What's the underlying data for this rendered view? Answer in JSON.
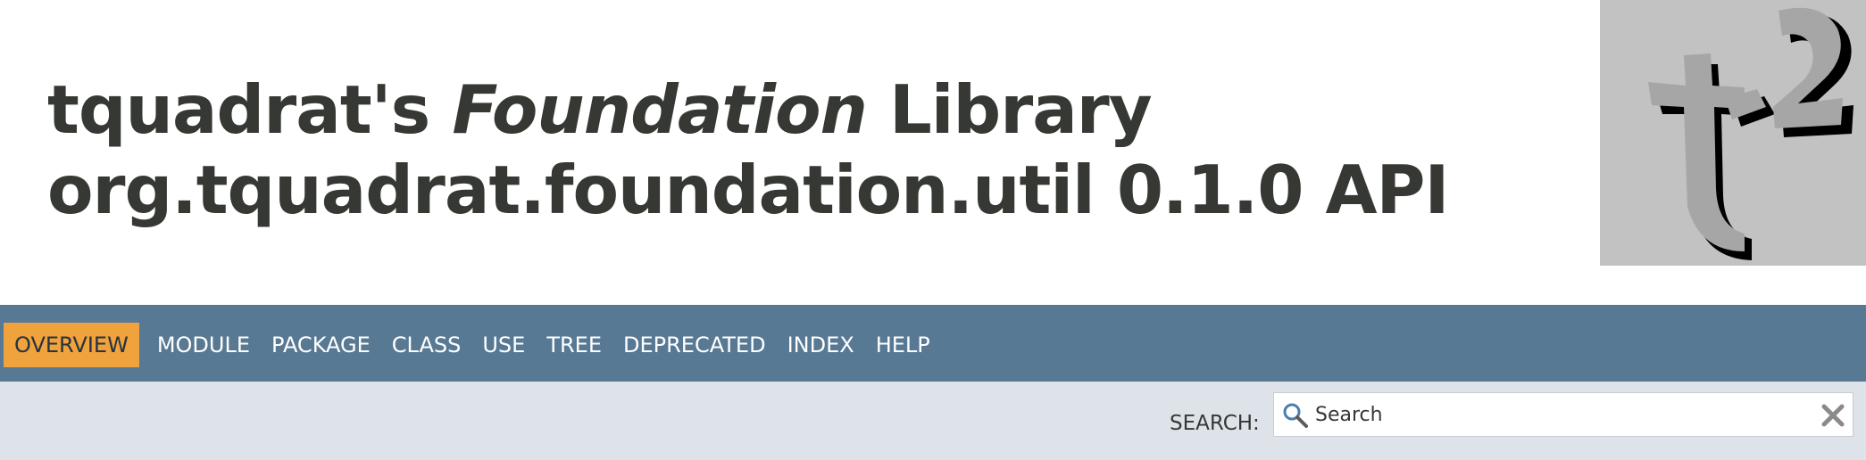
{
  "header": {
    "title_prefix": "tquadrat's ",
    "title_emphasis": "Foundation",
    "title_suffix": " Library",
    "subtitle": "org.tquadrat.foundation.util 0.1.0 API",
    "logo": {
      "icon": "tq-logo-icon",
      "text": "tq²"
    }
  },
  "navbar": {
    "items": [
      {
        "label": "OVERVIEW",
        "active": true
      },
      {
        "label": "MODULE",
        "active": false
      },
      {
        "label": "PACKAGE",
        "active": false
      },
      {
        "label": "CLASS",
        "active": false
      },
      {
        "label": "USE",
        "active": false
      },
      {
        "label": "TREE",
        "active": false
      },
      {
        "label": "DEPRECATED",
        "active": false
      },
      {
        "label": "INDEX",
        "active": false
      },
      {
        "label": "HELP",
        "active": false
      }
    ]
  },
  "search": {
    "label": "SEARCH:",
    "placeholder": "Search",
    "value": "",
    "search_icon": "search-icon",
    "reset_icon": "close-icon"
  },
  "colors": {
    "navbar": "#587994",
    "active_tab": "#f0a23c",
    "subnav": "#dee3e9",
    "title_text": "#353833"
  }
}
